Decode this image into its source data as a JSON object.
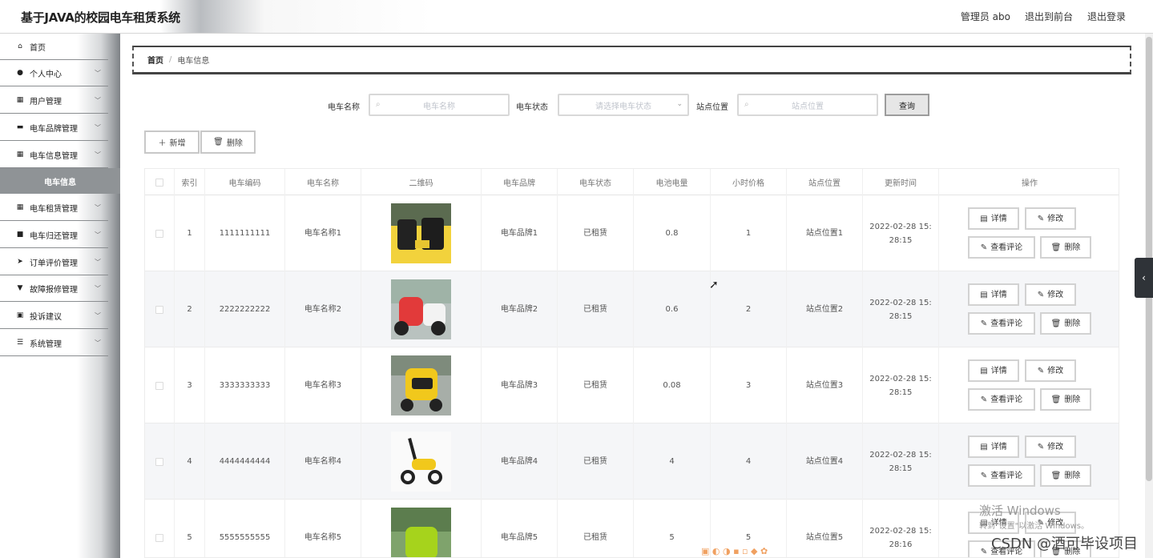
{
  "header": {
    "title": "基于JAVA的校园电车租赁系统",
    "user": "管理员 abo",
    "front": "退出到前台",
    "logout": "退出登录"
  },
  "sidebar": {
    "items": [
      {
        "label": "首页",
        "icon": "home-icon"
      },
      {
        "label": "个人中心",
        "icon": "user-icon"
      },
      {
        "label": "用户管理",
        "icon": "grid-icon"
      },
      {
        "label": "电车品牌管理",
        "icon": "briefcase-icon"
      },
      {
        "label": "电车信息管理",
        "icon": "grid-icon"
      }
    ],
    "active_sub": "电车信息",
    "items2": [
      {
        "label": "电车租赁管理",
        "icon": "grid-icon"
      },
      {
        "label": "电车归还管理",
        "icon": "bus-icon"
      },
      {
        "label": "订单评价管理",
        "icon": "send-icon"
      },
      {
        "label": "故障报修管理",
        "icon": "trophy-icon"
      },
      {
        "label": "投诉建议",
        "icon": "clipboard-icon"
      },
      {
        "label": "系统管理",
        "icon": "list-icon"
      }
    ]
  },
  "breadcrumb": {
    "home": "首页",
    "sep": "/",
    "current": "电车信息"
  },
  "search": {
    "name_label": "电车名称",
    "name_placeholder": "电车名称",
    "status_label": "电车状态",
    "status_placeholder": "请选择电车状态",
    "site_label": "站点位置",
    "site_placeholder": "站点位置",
    "query": "查询"
  },
  "actions": {
    "add": "新增",
    "delete": "删除"
  },
  "table": {
    "headers": [
      "索引",
      "电车编码",
      "电车名称",
      "二维码",
      "电车品牌",
      "电车状态",
      "电池电量",
      "小时价格",
      "站点位置",
      "更新时间",
      "操作"
    ],
    "rows": [
      {
        "idx": "1",
        "code": "1111111111",
        "name": "电车名称1",
        "brand": "电车品牌1",
        "status": "已租赁",
        "battery": "0.8",
        "price": "1",
        "site": "站点位置1",
        "time1": "2022-02-28 15:",
        "time2": "28:15"
      },
      {
        "idx": "2",
        "code": "2222222222",
        "name": "电车名称2",
        "brand": "电车品牌2",
        "status": "已租赁",
        "battery": "0.6",
        "price": "2",
        "site": "站点位置2",
        "time1": "2022-02-28 15:",
        "time2": "28:15"
      },
      {
        "idx": "3",
        "code": "3333333333",
        "name": "电车名称3",
        "brand": "电车品牌3",
        "status": "已租赁",
        "battery": "0.08",
        "price": "3",
        "site": "站点位置3",
        "time1": "2022-02-28 15:",
        "time2": "28:15"
      },
      {
        "idx": "4",
        "code": "4444444444",
        "name": "电车名称4",
        "brand": "电车品牌4",
        "status": "已租赁",
        "battery": "4",
        "price": "4",
        "site": "站点位置4",
        "time1": "2022-02-28 15:",
        "time2": "28:15"
      },
      {
        "idx": "5",
        "code": "5555555555",
        "name": "电车名称5",
        "brand": "电车品牌5",
        "status": "已租赁",
        "battery": "5",
        "price": "5",
        "site": "站点位置5",
        "time1": "2022-02-28 15:",
        "time2": "28:16"
      }
    ],
    "row_buttons": {
      "detail": "详情",
      "edit": "修改",
      "review": "查看评论",
      "delete": "删除"
    }
  },
  "overlay": {
    "watermark1": "激活 Windows",
    "watermark2": "转到\"设置\"以激活 Windows。",
    "csdn": "CSDN @酒可毕设项目"
  }
}
